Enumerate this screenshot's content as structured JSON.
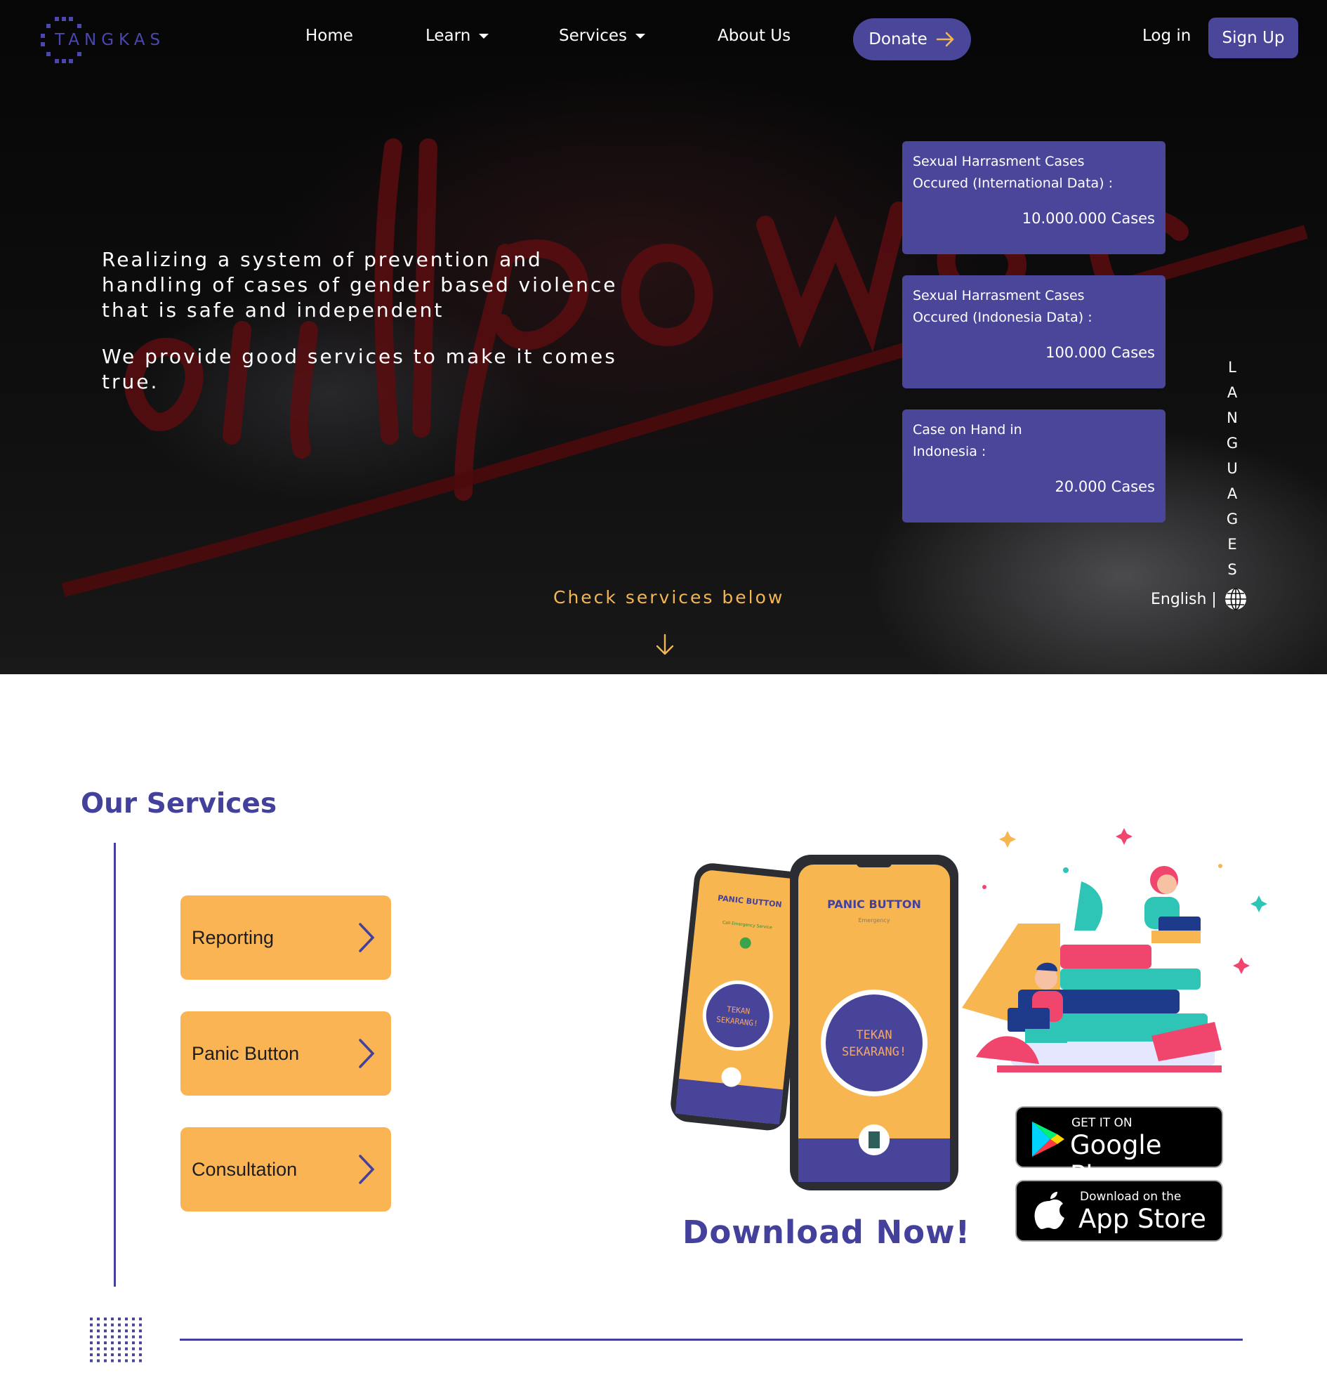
{
  "brand": {
    "logo_text": "TANGKAS"
  },
  "nav": {
    "home": "Home",
    "learn": "Learn",
    "services": "Services",
    "about": "About Us",
    "donate": "Donate",
    "login": "Log in",
    "signup": "Sign Up"
  },
  "hero": {
    "headline": "Realizing a system of prevention and handling of cases of gender based violence that is safe and independent",
    "subline": "We provide good services to make it comes true.",
    "check_services": "Check services below"
  },
  "stats": [
    {
      "label": "Sexual Harrasment Cases Occured (International Data) :",
      "value": "10.000.000 Cases"
    },
    {
      "label": "Sexual Harrasment Cases Occured (Indonesia Data) :",
      "value": "100.000 Cases"
    },
    {
      "label": "Case on Hand in Indonesia :",
      "value": "20.000 Cases"
    }
  ],
  "language": {
    "letters": [
      "L",
      "A",
      "N",
      "G",
      "U",
      "A",
      "G",
      "E",
      "S"
    ],
    "current": "English |"
  },
  "services": {
    "title": "Our Services",
    "items": [
      "Reporting",
      "Panic Button",
      "Consultation"
    ]
  },
  "app": {
    "phone_title": "PANIC BUTTON",
    "phone_sub": "Emergency",
    "phone_sub2": "Call Emergency Service",
    "phone_button_1": "TEKAN",
    "phone_button_2": "SEKARANG!",
    "download": "Download Now!",
    "google_small": "GET IT ON",
    "google_big": "Google Play",
    "apple_small": "Download on the",
    "apple_big": "App Store"
  },
  "colors": {
    "primary": "#4a469a",
    "accent": "#fbb454",
    "check": "#f3b655"
  }
}
